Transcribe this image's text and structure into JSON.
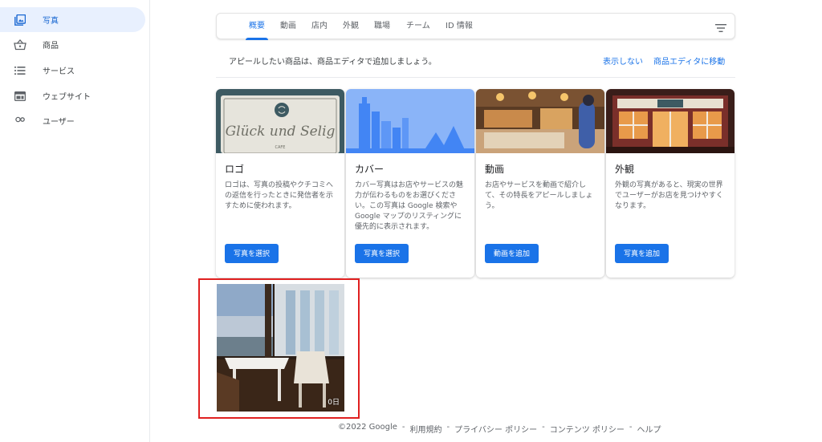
{
  "sidebar": {
    "items": [
      {
        "label": "写真",
        "icon": "photo-library-icon",
        "active": true
      },
      {
        "label": "商品",
        "icon": "shopping-basket-icon",
        "active": false
      },
      {
        "label": "サービス",
        "icon": "list-icon",
        "active": false
      },
      {
        "label": "ウェブサイト",
        "icon": "web-icon",
        "active": false
      },
      {
        "label": "ユーザー",
        "icon": "users-icon",
        "active": false
      }
    ]
  },
  "tabs": [
    {
      "label": "概要",
      "active": true
    },
    {
      "label": "動画",
      "active": false
    },
    {
      "label": "店内",
      "active": false
    },
    {
      "label": "外観",
      "active": false
    },
    {
      "label": "職場",
      "active": false
    },
    {
      "label": "チーム",
      "active": false
    },
    {
      "label": "ID 情報",
      "active": false
    }
  ],
  "info": {
    "text": "アピールしたい商品は、商品エディタで追加しましょう。",
    "dismiss": "表示しない",
    "goto_editor": "商品エディタに移動"
  },
  "cards": [
    {
      "title": "ロゴ",
      "desc": "ロゴは、写真の投稿やクチコミへの返信を行ったときに発信者を示すために使われます。",
      "button": "写真を選択",
      "logo_text": "Glück und Selig",
      "logo_sub": "CAFE"
    },
    {
      "title": "カバー",
      "desc": "カバー写真はお店やサービスの魅力が伝わるものをお選びください。この写真は Google 検索や Google マップのリスティングに優先的に表示されます。",
      "button": "写真を選択"
    },
    {
      "title": "動画",
      "desc": "お店やサービスを動画で紹介して、その特長をアピールしましょう。",
      "button": "動画を追加"
    },
    {
      "title": "外観",
      "desc": "外観の写真があると、現実の世界でユーザーがお店を見つけやすくなります。",
      "button": "写真を追加"
    }
  ],
  "photo": {
    "age": "0日"
  },
  "footer": {
    "copyright": "©2022 Google",
    "links": [
      "利用規約",
      "プライバシー ポリシー",
      "コンテンツ ポリシー",
      "ヘルプ"
    ],
    "separator": "-"
  },
  "colors": {
    "accent": "#1a73e8",
    "highlight": "#e02020",
    "active_nav_bg": "#e8f0fe"
  }
}
